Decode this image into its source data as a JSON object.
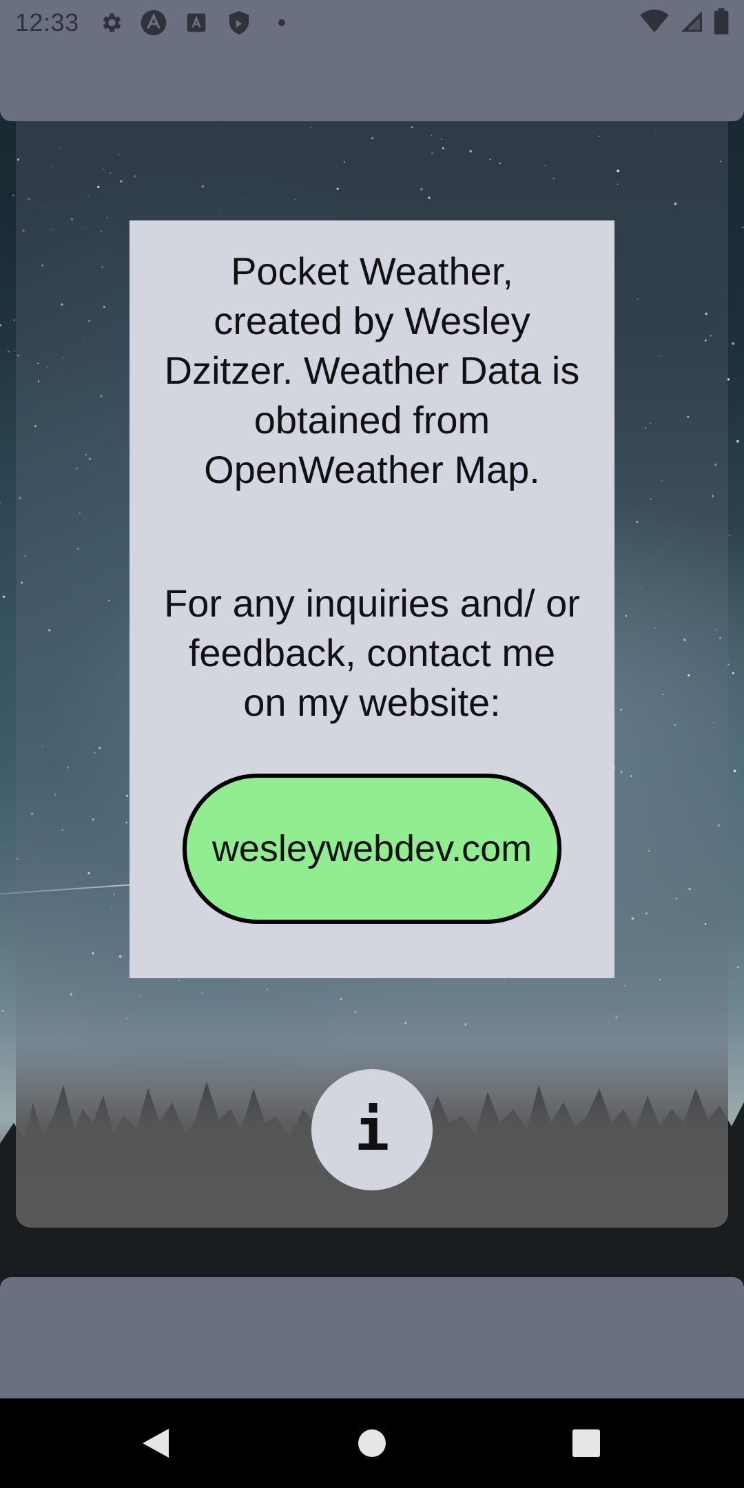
{
  "status_bar": {
    "time": "12:33",
    "icons_left": [
      "settings-icon",
      "app-a-icon",
      "font-a-icon",
      "shield-icon",
      "dot-icon"
    ],
    "icons_right": [
      "wifi-icon",
      "signal-icon",
      "battery-icon"
    ]
  },
  "card": {
    "paragraph_1": "Pocket Weather, created by Wesley Dzitzer. Weather Data is obtained from OpenWeather Map.",
    "paragraph_2": "For any inquiries and/ or feedback, contact me on my website:",
    "website_button_label": "wesleywebdev.com"
  },
  "info_button": {
    "label": "i"
  },
  "colors": {
    "bars": "#6b7080",
    "card": "#d3d6de",
    "button_green": "#90ee90"
  }
}
